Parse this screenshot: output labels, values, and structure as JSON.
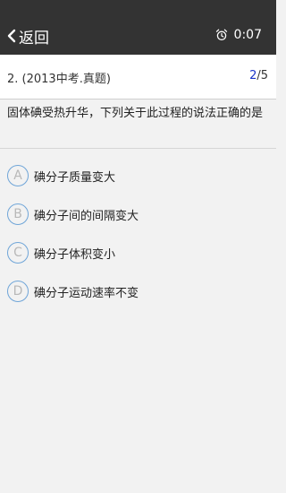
{
  "header": {
    "back_label": "返回",
    "timer": "0:07"
  },
  "question": {
    "number_label": "2. (2013中考.真题)",
    "progress_current": "2",
    "progress_total": "/5",
    "text": "固体碘受热升华，下列关于此过程的说法正确的是"
  },
  "options": [
    {
      "letter": "A",
      "text": "碘分子质量变大"
    },
    {
      "letter": "B",
      "text": "碘分子间的间隔变大"
    },
    {
      "letter": "C",
      "text": "碘分子体积变小"
    },
    {
      "letter": "D",
      "text": "碘分子运动速率不变"
    }
  ],
  "colors": {
    "topbar": "#333333",
    "accent_blue": "#1a33c8",
    "option_ring": "#6fa5d8",
    "background": "#f2f2f2"
  }
}
